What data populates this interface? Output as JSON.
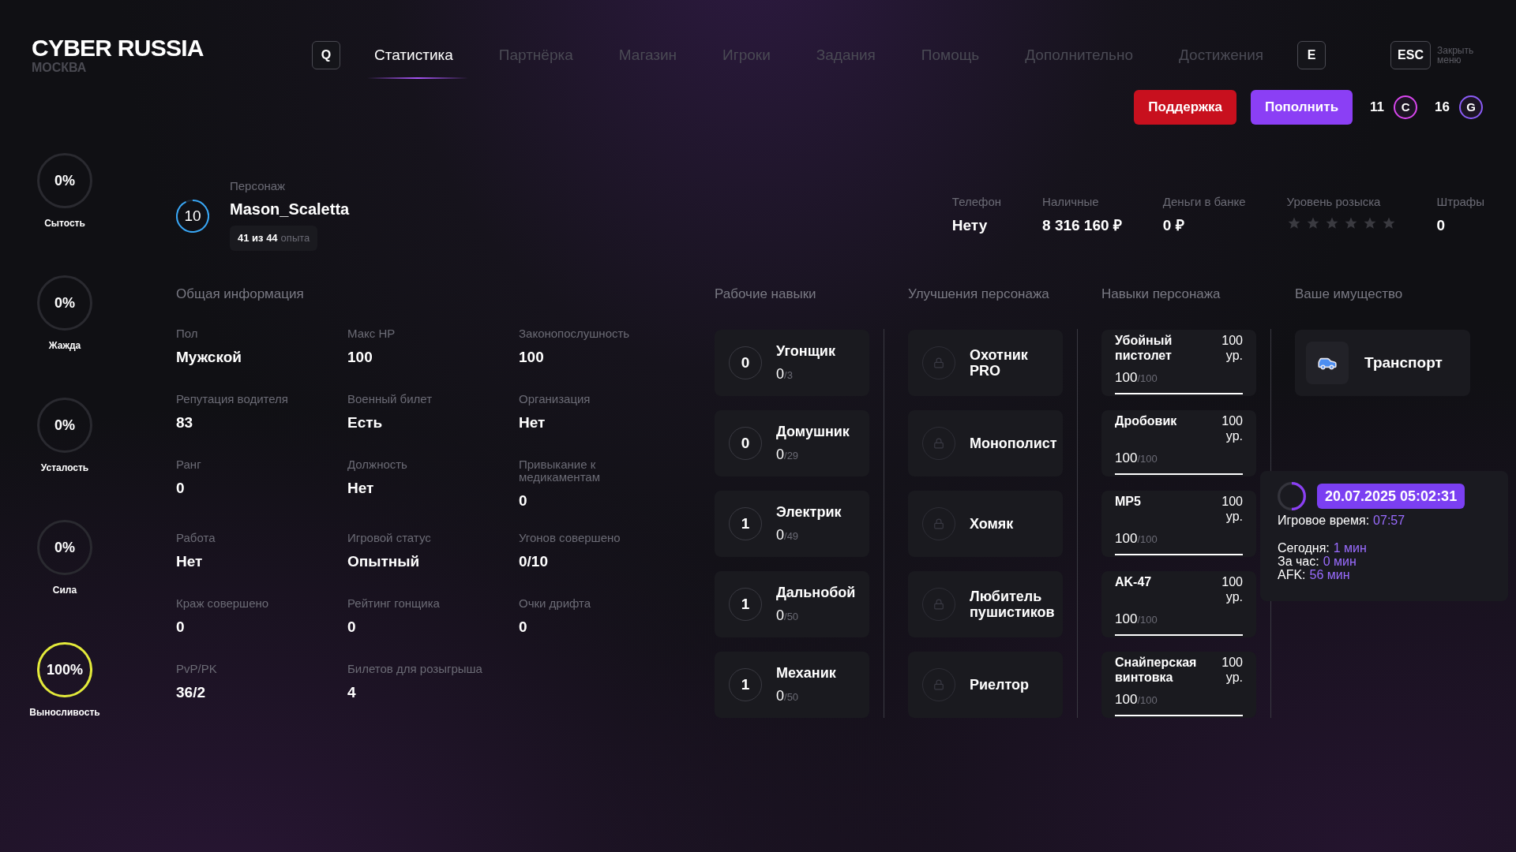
{
  "logo": {
    "title": "CYBER RUSSIA",
    "city": "МОСКВА"
  },
  "nav": {
    "prev_key": "Q",
    "next_key": "E",
    "tabs": [
      {
        "label": "Статистика",
        "selected": true
      },
      {
        "label": "Партнёрка",
        "selected": false
      },
      {
        "label": "Магазин",
        "selected": false
      },
      {
        "label": "Игроки",
        "selected": false
      },
      {
        "label": "Задания",
        "selected": false
      },
      {
        "label": "Помощь",
        "selected": false
      },
      {
        "label": "Дополнительно",
        "selected": false
      },
      {
        "label": "Достижения",
        "selected": false
      }
    ],
    "close_key": "ESC",
    "close_label": "Закрыть меню"
  },
  "actions": {
    "support": "Поддержка",
    "top_up": "Пополнить",
    "currencies": [
      {
        "amount": "11",
        "symbol": "C",
        "color": "#d946ef"
      },
      {
        "amount": "16",
        "symbol": "G",
        "color": "#8b5cf6"
      }
    ]
  },
  "vitals": [
    {
      "label": "Сытость",
      "value": "0%",
      "level": 0
    },
    {
      "label": "Жажда",
      "value": "0%",
      "level": 0
    },
    {
      "label": "Усталость",
      "value": "0%",
      "level": 0
    },
    {
      "label": "Сила",
      "value": "0%",
      "level": 0
    },
    {
      "label": "Выносливость",
      "value": "100%",
      "level": 1
    }
  ],
  "character": {
    "level_number": "10",
    "level": 0.93,
    "label": "Персонаж",
    "name": "Mason_Scaletta",
    "xp_current": "41 из 44",
    "xp_unit": "опыта"
  },
  "summary": [
    {
      "label": "Телефон",
      "value": "Нету",
      "kind": "text"
    },
    {
      "label": "Наличные",
      "value": "8 316 160 ₽",
      "kind": "text"
    },
    {
      "label": "Деньги в банке",
      "value": "0 ₽",
      "kind": "text"
    },
    {
      "label": "Уровень розыска",
      "stars": 0,
      "kind": "stars"
    },
    {
      "label": "Штрафы",
      "value": "0",
      "kind": "text"
    }
  ],
  "general_info": {
    "title": "Общая информация",
    "fields": [
      {
        "label": "Пол",
        "value": "Мужской"
      },
      {
        "label": "Макс HP",
        "value": "100"
      },
      {
        "label": "Законопослушность",
        "value": "100"
      },
      {
        "label": "Репутация водителя",
        "value": "83"
      },
      {
        "label": "Военный билет",
        "value": "Есть"
      },
      {
        "label": "Организация",
        "value": "Нет"
      },
      {
        "label": "Ранг",
        "value": "0"
      },
      {
        "label": "Должность",
        "value": "Нет"
      },
      {
        "label": "Привыкание к медикаментам",
        "value": "0"
      },
      {
        "label": "Работа",
        "value": "Нет"
      },
      {
        "label": "Игровой статус",
        "value": "Опытный"
      },
      {
        "label": "Угонов совершено",
        "value": "0/10"
      },
      {
        "label": "Краж совершено",
        "value": "0"
      },
      {
        "label": "Рейтинг гонщика",
        "value": "0"
      },
      {
        "label": "Очки дрифта",
        "value": "0"
      },
      {
        "label": "PvP/PK",
        "value": "36/2"
      },
      {
        "label": "Билетов для розыгрыша",
        "value": "4"
      }
    ]
  },
  "work_skills": {
    "title": "Рабочие навыки",
    "items": [
      {
        "rank": "0",
        "name": "Угонщик",
        "progress": "0",
        "total": "/3"
      },
      {
        "rank": "0",
        "name": "Домушник",
        "progress": "0",
        "total": "/29"
      },
      {
        "rank": "1",
        "name": "Электрик",
        "progress": "0",
        "total": "/49"
      },
      {
        "rank": "1",
        "name": "Дальнобой",
        "progress": "0",
        "total": "/50"
      },
      {
        "rank": "1",
        "name": "Механик",
        "progress": "0",
        "total": "/50"
      }
    ]
  },
  "upgrades": {
    "title": "Улучшения персонажа",
    "items": [
      {
        "name": "Охотник PRO",
        "locked": true
      },
      {
        "name": "Монополист",
        "locked": true
      },
      {
        "name": "Хомяк",
        "locked": true
      },
      {
        "name": "Любитель пушистиков",
        "locked": true
      },
      {
        "name": "Риелтор",
        "locked": true
      }
    ]
  },
  "character_skills": {
    "title": "Навыки персонажа",
    "items": [
      {
        "name": "Убойный пистолет",
        "grade": "100 ур.",
        "progress": "100",
        "total": "/100",
        "level": 1
      },
      {
        "name": "Дробовик",
        "grade": "100 ур.",
        "progress": "100",
        "total": "/100",
        "level": 1
      },
      {
        "name": "MP5",
        "grade": "100 ур.",
        "progress": "100",
        "total": "/100",
        "level": 1
      },
      {
        "name": "AK-47",
        "grade": "100 ур.",
        "progress": "100",
        "total": "/100",
        "level": 1
      },
      {
        "name": "Снайперская винтовка",
        "grade": "100 ур.",
        "progress": "100",
        "total": "/100",
        "level": 1
      }
    ]
  },
  "property": {
    "title": "Ваше имущество",
    "items": [
      {
        "name": "Транспорт"
      }
    ]
  },
  "session_popup": {
    "datetime": "20.07.2025 05:02:31",
    "lines": [
      {
        "label": "Игровое время:",
        "value": "07:57"
      },
      {
        "label": "Сегодня:",
        "value": "1 мин"
      },
      {
        "label": "За час:",
        "value": "0 мин"
      },
      {
        "label": "AFK:",
        "value": "56 мин"
      }
    ]
  }
}
